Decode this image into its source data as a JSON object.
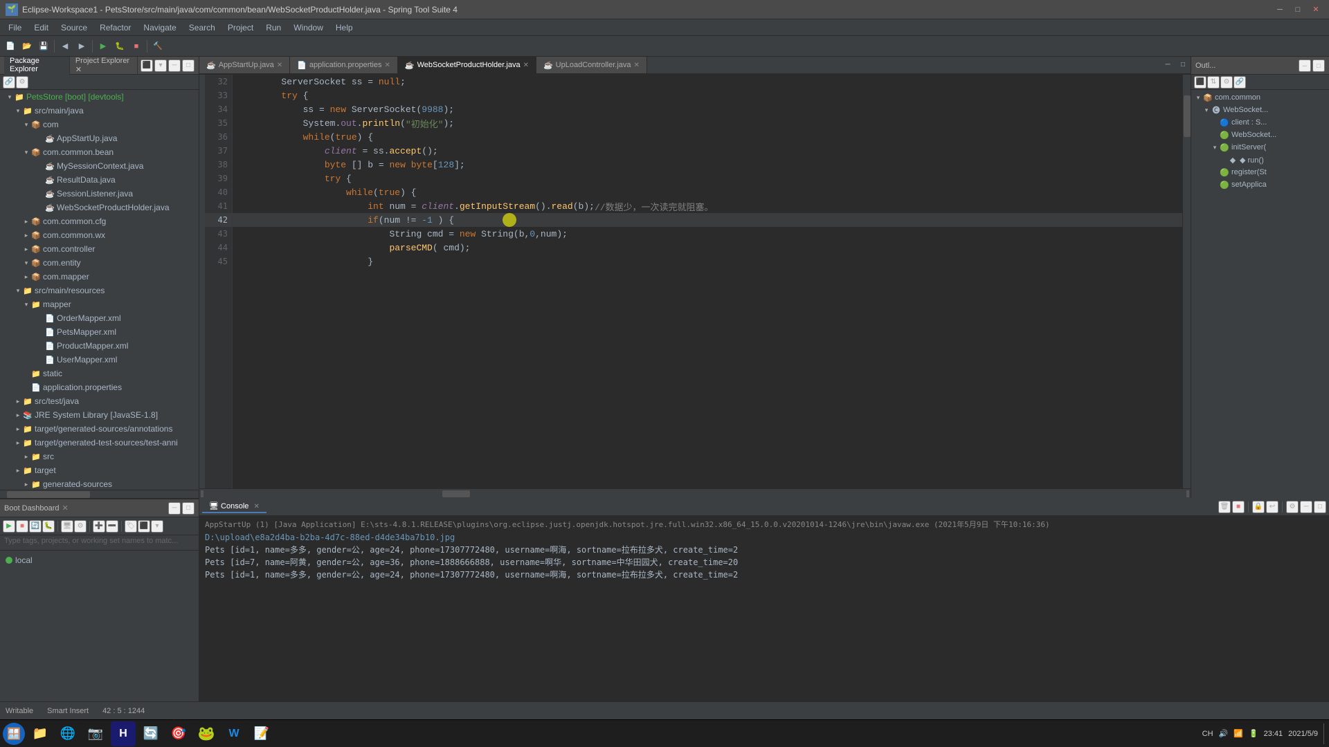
{
  "titleBar": {
    "title": "Eclipse-Workspace1 - PetsStore/src/main/java/com/common/bean/WebSocketProductHolder.java - Spring Tool Suite 4"
  },
  "menuBar": {
    "items": [
      "File",
      "Edit",
      "Source",
      "Refactor",
      "Navigate",
      "Search",
      "Project",
      "Run",
      "Window",
      "Help"
    ]
  },
  "leftPanel": {
    "tabs": [
      {
        "label": "Package Explorer",
        "active": true
      },
      {
        "label": "Project Explorer",
        "active": false
      }
    ],
    "tree": [
      {
        "indent": 0,
        "arrow": "▾",
        "icon": "📁",
        "label": "PetsStore [boot] [devtools]",
        "color": "green"
      },
      {
        "indent": 1,
        "arrow": "▾",
        "icon": "📁",
        "label": "src/main/java",
        "color": ""
      },
      {
        "indent": 2,
        "arrow": "▾",
        "icon": "📁",
        "label": "com",
        "color": ""
      },
      {
        "indent": 3,
        "arrow": " ",
        "icon": "☕",
        "label": "AppStartUp.java",
        "color": ""
      },
      {
        "indent": 2,
        "arrow": "▾",
        "icon": "📁",
        "label": "com.common.bean",
        "color": ""
      },
      {
        "indent": 3,
        "arrow": " ",
        "icon": "☕",
        "label": "MySessionContext.java",
        "color": ""
      },
      {
        "indent": 3,
        "arrow": " ",
        "icon": "☕",
        "label": "ResultData.java",
        "color": ""
      },
      {
        "indent": 3,
        "arrow": " ",
        "icon": "☕",
        "label": "SessionListener.java",
        "color": ""
      },
      {
        "indent": 3,
        "arrow": " ",
        "icon": "☕",
        "label": "WebSocketProductHolder.java",
        "color": ""
      },
      {
        "indent": 2,
        "arrow": "▸",
        "icon": "📁",
        "label": "com.common.cfg",
        "color": ""
      },
      {
        "indent": 2,
        "arrow": "▸",
        "icon": "📁",
        "label": "com.common.wx",
        "color": ""
      },
      {
        "indent": 2,
        "arrow": "▸",
        "icon": "📁",
        "label": "com.controller",
        "color": ""
      },
      {
        "indent": 2,
        "arrow": "▾",
        "icon": "📁",
        "label": "com.entity",
        "color": ""
      },
      {
        "indent": 2,
        "arrow": "▸",
        "icon": "📁",
        "label": "com.mapper",
        "color": ""
      },
      {
        "indent": 1,
        "arrow": "▾",
        "icon": "📁",
        "label": "src/main/resources",
        "color": ""
      },
      {
        "indent": 2,
        "arrow": "▾",
        "icon": "📁",
        "label": "mapper",
        "color": ""
      },
      {
        "indent": 3,
        "arrow": " ",
        "icon": "📄",
        "label": "OrderMapper.xml",
        "color": ""
      },
      {
        "indent": 3,
        "arrow": " ",
        "icon": "📄",
        "label": "PetsMapper.xml",
        "color": ""
      },
      {
        "indent": 3,
        "arrow": " ",
        "icon": "📄",
        "label": "ProductMapper.xml",
        "color": ""
      },
      {
        "indent": 3,
        "arrow": " ",
        "icon": "📄",
        "label": "UserMapper.xml",
        "color": ""
      },
      {
        "indent": 2,
        "arrow": " ",
        "icon": "📁",
        "label": "static",
        "color": ""
      },
      {
        "indent": 2,
        "arrow": " ",
        "icon": "📄",
        "label": "application.properties",
        "color": ""
      },
      {
        "indent": 1,
        "arrow": "▸",
        "icon": "📁",
        "label": "src/test/java",
        "color": ""
      },
      {
        "indent": 1,
        "arrow": "▸",
        "icon": "📁",
        "label": "JRE System Library [JavaSE-1.8]",
        "color": ""
      },
      {
        "indent": 1,
        "arrow": "▸",
        "icon": "📁",
        "label": "target/generated-sources/annotations",
        "color": ""
      },
      {
        "indent": 1,
        "arrow": "▸",
        "icon": "📁",
        "label": "target/generated-test-sources/test-anni",
        "color": ""
      },
      {
        "indent": 2,
        "arrow": "▸",
        "icon": "📁",
        "label": "src",
        "color": ""
      },
      {
        "indent": 1,
        "arrow": "▸",
        "icon": "📁",
        "label": "target",
        "color": ""
      },
      {
        "indent": 2,
        "arrow": "▸",
        "icon": "📁",
        "label": "generated-sources",
        "color": ""
      }
    ]
  },
  "editorTabs": [
    {
      "label": "AppStartUp.java",
      "active": false
    },
    {
      "label": "application.properties",
      "active": false
    },
    {
      "label": "WebSocketProductHolder.java",
      "active": true,
      "modified": true
    },
    {
      "label": "UpLoadController.java",
      "active": false
    }
  ],
  "codeLines": [
    {
      "num": 32,
      "content": "        ServerSocket ss = null;"
    },
    {
      "num": 33,
      "content": "        try {"
    },
    {
      "num": 34,
      "content": "            ss = new ServerSocket(9988);"
    },
    {
      "num": 35,
      "content": "            System.out.println(\"初始化\");"
    },
    {
      "num": 36,
      "content": "            while(true) {"
    },
    {
      "num": 37,
      "content": "                client = ss.accept();"
    },
    {
      "num": 38,
      "content": "                byte [] b = new byte[128];"
    },
    {
      "num": 39,
      "content": "                try {"
    },
    {
      "num": 40,
      "content": "                    while(true) {"
    },
    {
      "num": 41,
      "content": "                        int num = client.getInputStream().read(b);//数据少，一次读完就阻塞。"
    },
    {
      "num": 42,
      "content": "                        if(num != -1 ) {",
      "highlighted": true
    },
    {
      "num": 43,
      "content": "                            String cmd = new String(b,0,num);"
    },
    {
      "num": 44,
      "content": "                            parseCMD( cmd);"
    },
    {
      "num": 45,
      "content": "                        }"
    }
  ],
  "outlinePanel": {
    "title": "Outl...",
    "items": [
      {
        "indent": 0,
        "label": "com.common",
        "arrow": "▾"
      },
      {
        "indent": 1,
        "label": "WebSocket...",
        "arrow": "▾"
      },
      {
        "indent": 2,
        "label": "client : S...",
        "arrow": " "
      },
      {
        "indent": 2,
        "label": "WebSocket...",
        "arrow": " "
      },
      {
        "indent": 2,
        "label": "initServer(",
        "arrow": "▾"
      },
      {
        "indent": 3,
        "label": "◆ run()",
        "arrow": " "
      },
      {
        "indent": 3,
        "label": "register(St",
        "arrow": " "
      },
      {
        "indent": 3,
        "label": "setApplica",
        "arrow": " "
      }
    ]
  },
  "console": {
    "title": "Console",
    "commandLine": "AppStartUp (1) [Java Application] E:\\sts-4.8.1.RELEASE\\plugins\\org.eclipse.justj.openjdk.hotspot.jre.full.win32.x86_64_15.0.0.v20201014-1246\\jre\\bin\\javaw.exe  (2021年5月9日 下午10:16:36)",
    "lines": [
      {
        "text": "D:\\upload\\e8a2d4ba-b2ba-4d7c-88ed-d4de34ba7b10.jpg",
        "type": "cmd"
      },
      {
        "text": "Pets [id=1, name=多多, gender=公, age=24, phone=17307772480, username=啊海, sortname=拉布拉多犬, create_time=2",
        "type": "normal"
      },
      {
        "text": "Pets [id=7, name=阿黄, gender=公, age=36, phone=1888666888, username=啊华, sortname=中华田园犬, create_time=20",
        "type": "normal"
      },
      {
        "text": "Pets [id=1, name=多多, gender=公, age=24, phone=17307772480, username=啊海, sortname=拉布拉多犬, create_time=2",
        "type": "normal"
      }
    ]
  },
  "bootDashboard": {
    "title": "Boot Dashboard",
    "searchPlaceholder": "Type tags, projects, or working set names to matc...",
    "items": [
      {
        "label": "local",
        "running": true
      }
    ]
  },
  "statusBar": {
    "writable": "Writable",
    "insertMode": "Smart Insert",
    "position": "42 : 5 : 1244"
  },
  "taskbar": {
    "items": [
      "🪟",
      "📁",
      "🌐",
      "📷",
      "H",
      "🔄",
      "🎯",
      "🐸",
      "W",
      "📝"
    ]
  }
}
